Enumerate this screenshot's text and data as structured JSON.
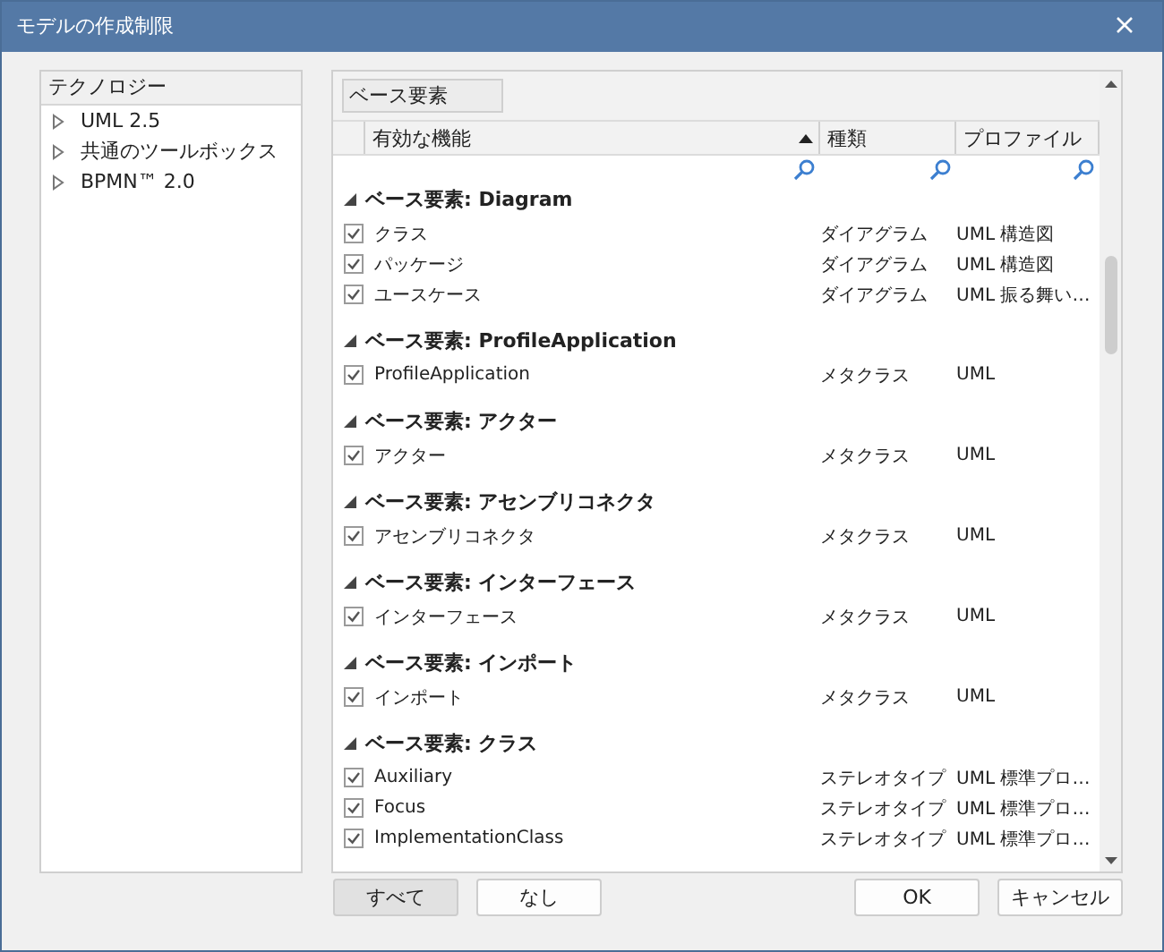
{
  "window": {
    "title": "モデルの作成制限"
  },
  "technology": {
    "header": "テクノロジー",
    "items": [
      {
        "label": "UML 2.5",
        "expanded": false
      },
      {
        "label": "共通のツールボックス",
        "expanded": false
      },
      {
        "label": "BPMN™ 2.0",
        "expanded": false
      }
    ]
  },
  "features": {
    "group_by": "ベース要素",
    "columns": [
      {
        "label": "有効な機能",
        "sorted": true
      },
      {
        "label": "種類",
        "sorted": false
      },
      {
        "label": "プロファイル",
        "sorted": false
      }
    ],
    "groups": [
      {
        "title": "ベース要素: Diagram",
        "expanded": true,
        "items": [
          {
            "name": "クラス",
            "checked": true,
            "kind": "ダイアグラム",
            "profile": "UML 構造図"
          },
          {
            "name": "パッケージ",
            "checked": true,
            "kind": "ダイアグラム",
            "profile": "UML 構造図"
          },
          {
            "name": "ユースケース",
            "checked": true,
            "kind": "ダイアグラム",
            "profile": "UML 振る舞い…"
          }
        ]
      },
      {
        "title": "ベース要素: ProfileApplication",
        "expanded": true,
        "items": [
          {
            "name": "ProfileApplication",
            "checked": true,
            "kind": "メタクラス",
            "profile": "UML"
          }
        ]
      },
      {
        "title": "ベース要素: アクター",
        "expanded": true,
        "items": [
          {
            "name": "アクター",
            "checked": true,
            "kind": "メタクラス",
            "profile": "UML"
          }
        ]
      },
      {
        "title": "ベース要素: アセンブリコネクタ",
        "expanded": true,
        "items": [
          {
            "name": "アセンブリコネクタ",
            "checked": true,
            "kind": "メタクラス",
            "profile": "UML"
          }
        ]
      },
      {
        "title": "ベース要素: インターフェース",
        "expanded": true,
        "items": [
          {
            "name": "インターフェース",
            "checked": true,
            "kind": "メタクラス",
            "profile": "UML"
          }
        ]
      },
      {
        "title": "ベース要素: インポート",
        "expanded": true,
        "items": [
          {
            "name": "インポート",
            "checked": true,
            "kind": "メタクラス",
            "profile": "UML"
          }
        ]
      },
      {
        "title": "ベース要素: クラス",
        "expanded": true,
        "items": [
          {
            "name": "Auxiliary",
            "checked": true,
            "kind": "ステレオタイプ",
            "profile": "UML 標準プロ…"
          },
          {
            "name": "Focus",
            "checked": true,
            "kind": "ステレオタイプ",
            "profile": "UML 標準プロ…"
          },
          {
            "name": "ImplementationClass",
            "checked": true,
            "kind": "ステレオタイプ",
            "profile": "UML 標準プロ…"
          }
        ]
      }
    ]
  },
  "buttons_left": [
    {
      "label": "すべて",
      "pressed": true
    },
    {
      "label": "なし",
      "pressed": false
    }
  ],
  "buttons_right": [
    {
      "label": "OK",
      "pressed": false
    },
    {
      "label": "キャンセル",
      "pressed": false
    }
  ]
}
